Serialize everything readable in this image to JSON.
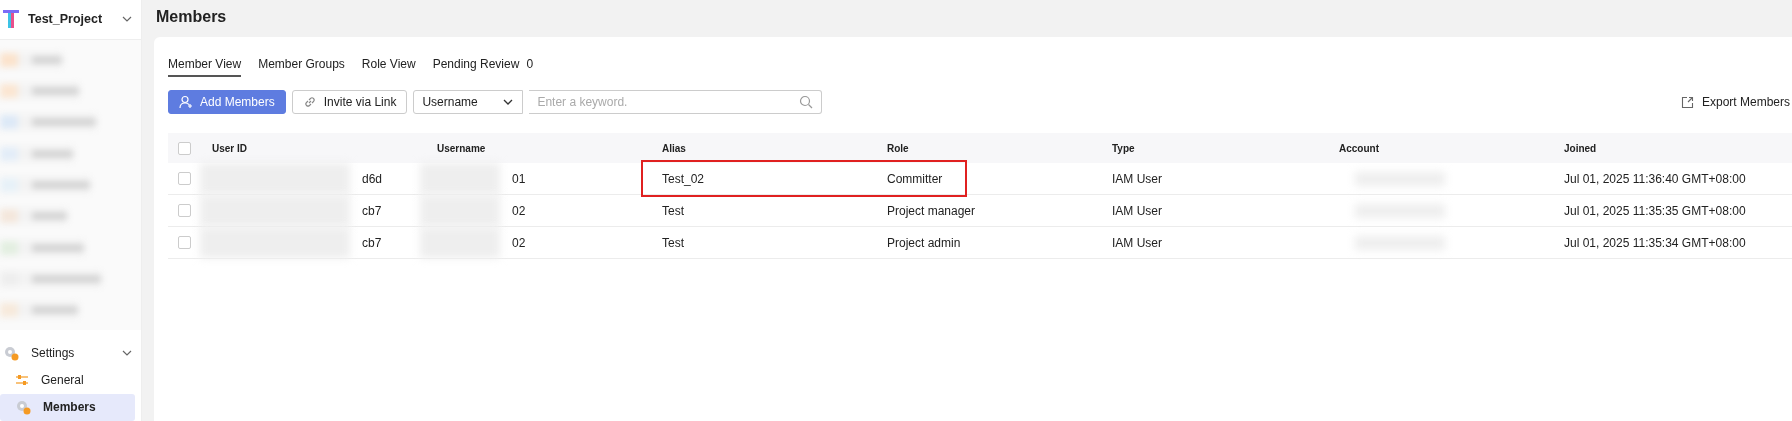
{
  "sidebar": {
    "project": "Test_Project",
    "items": [
      {
        "kind": "redacted"
      },
      {
        "kind": "redacted"
      },
      {
        "kind": "redacted"
      },
      {
        "kind": "redacted"
      },
      {
        "kind": "redacted"
      },
      {
        "kind": "redacted"
      },
      {
        "kind": "redacted"
      },
      {
        "kind": "redacted"
      },
      {
        "kind": "redacted"
      },
      {
        "kind": "group",
        "label": "Settings",
        "expanded": true,
        "children": [
          {
            "label": "General",
            "selected": false
          },
          {
            "label": "Members",
            "selected": true
          }
        ]
      }
    ]
  },
  "page": {
    "title": "Members"
  },
  "tabs": [
    {
      "label": "Member View",
      "selected": true
    },
    {
      "label": "Member Groups",
      "selected": false
    },
    {
      "label": "Role View",
      "selected": false
    },
    {
      "label": "Pending Review",
      "count": "0",
      "selected": false
    }
  ],
  "toolbar": {
    "add_button": "Add Members",
    "invite_button": "Invite via Link",
    "filter": "Username",
    "search": {
      "placeholder": "Enter a keyword."
    },
    "export": "Export Members"
  },
  "table": {
    "columns": [
      "User ID",
      "Username",
      "Alias",
      "Role",
      "Type",
      "Account",
      "Joined"
    ],
    "select_all_checked": false,
    "rows": [
      {
        "checked": false,
        "user_id": "d6d",
        "username": "01",
        "alias": "Test_02",
        "role": "Committer",
        "type": "IAM User",
        "joined": "Jul 01, 2025 11:36:40 GMT+08:00",
        "highlighted": true
      },
      {
        "checked": false,
        "user_id": "cb7",
        "username": "02",
        "alias": "Test",
        "role": "Project manager",
        "type": "IAM User",
        "joined": "Jul 01, 2025 11:35:35 GMT+08:00",
        "highlighted": false
      },
      {
        "checked": false,
        "user_id": "cb7",
        "username": "02",
        "alias": "Test",
        "role": "Project admin",
        "type": "IAM User",
        "joined": "Jul 01, 2025 11:35:34 GMT+08:00",
        "highlighted": false
      }
    ]
  }
}
